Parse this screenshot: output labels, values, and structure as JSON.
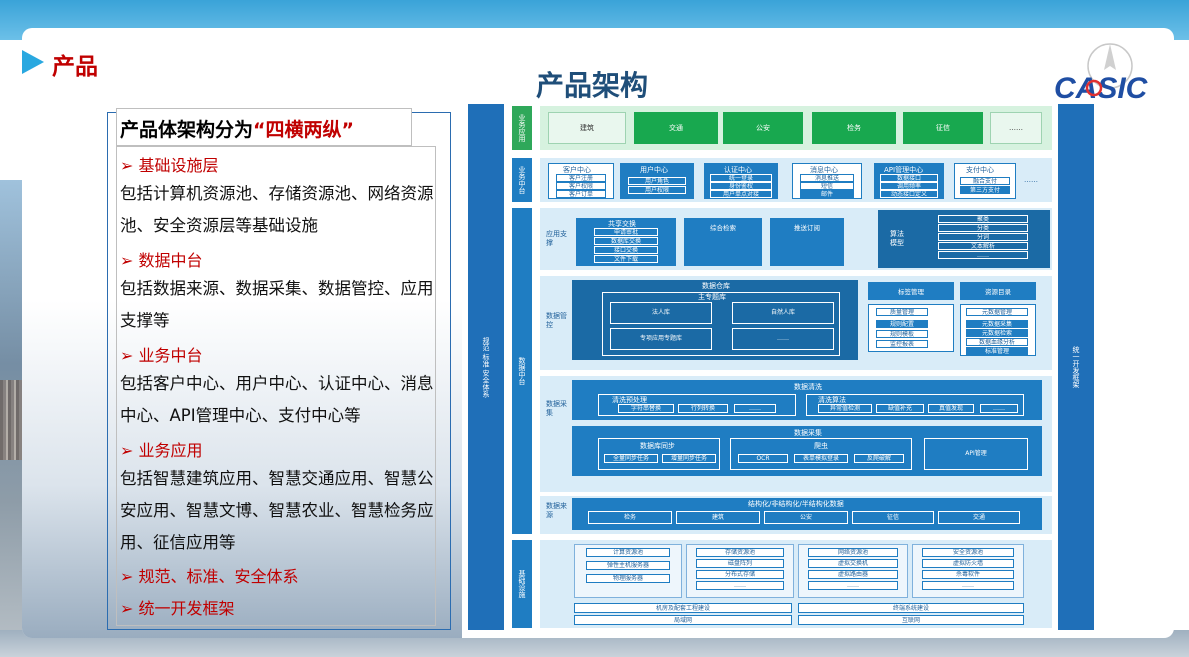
{
  "section_title": "产品",
  "main_title": "产品架构",
  "logo_text": "CASIC",
  "left": {
    "headline_prefix": "产品体架构分为",
    "headline_quote": "“四横两纵”",
    "items": [
      {
        "title": "➢ 基础设施层",
        "desc": "包括计算机资源池、存储资源池、网络资源池、安全资源层等基础设施"
      },
      {
        "title": "➢ 数据中台",
        "desc": "包括数据来源、数据采集、数据管控、应用支撑等"
      },
      {
        "title": "➢ 业务中台",
        "desc": "包括客户中心、用户中心、认证中心、消息中心、API管理中心、支付中心等"
      },
      {
        "title": "➢ 业务应用",
        "desc": "包括智慧建筑应用、智慧交通应用、智慧公安应用、智慧文博、智慧农业、智慧检务应用、征信应用等"
      },
      {
        "title": "➢ 规范、标准、安全体系",
        "desc": ""
      },
      {
        "title": "➢ 统一开发框架",
        "desc": ""
      }
    ]
  },
  "diagram": {
    "left_bar": "规范 标准 安全体系",
    "right_bar": "统一开发框架",
    "biz_app": {
      "tag": "业务应用",
      "items": [
        "建筑",
        "交通",
        "公安",
        "检务",
        "征信",
        "……"
      ]
    },
    "biz_mid": {
      "tag": "业务中台",
      "centers": [
        {
          "title": "客户中心",
          "subs": [
            "客户注册",
            "客户权限",
            "客户订单"
          ]
        },
        {
          "title": "用户中心",
          "subs": [
            "用户角色",
            "用户权限"
          ]
        },
        {
          "title": "认证中心",
          "subs": [
            "统一登录",
            "身份鉴权",
            "用户单点对接"
          ]
        },
        {
          "title": "消息中心",
          "subs": [
            "消息推送",
            "短信",
            "邮件"
          ]
        },
        {
          "title": "API管理中心",
          "subs": [
            "数据接口",
            "调用频率",
            "动态接口定义"
          ]
        },
        {
          "title": "支付中心",
          "subs": [
            "融合支付",
            "第三方支付"
          ]
        }
      ],
      "more": "……"
    },
    "data_mid_tag": "数据中台",
    "app_support": {
      "tag": "应用支撑",
      "share_title": "共享交换",
      "share_items": [
        "申请审批",
        "数据库交换",
        "接口交换",
        "文件下载"
      ],
      "search": "综合检索",
      "push": "推送订阅",
      "algo_tag": "算法模型",
      "algo_items": [
        "聚类",
        "分类",
        "分词",
        "文本解析",
        "……"
      ]
    },
    "data_govern": {
      "tag": "数据管控",
      "warehouse": "数据仓库",
      "theme": "主专题库",
      "corp": "法人库",
      "nature": "自然人库",
      "special": "专项应用专题库",
      "more": "……",
      "label_mgmt": "标签管理",
      "label_items": [
        "质量管理",
        "规则配置",
        "规则模板",
        "监控报表"
      ],
      "res_catalog": "资源目录",
      "res_items": [
        "元数据管理",
        "元数据采集",
        "元数据检索",
        "数据血缘分析",
        "标准管理"
      ]
    },
    "data_collect": {
      "tag": "数据采集",
      "clean": "数据清洗",
      "pre": "清洗预处理",
      "pre_items": [
        "字符串替换",
        "行列转换",
        "……"
      ],
      "algo": "清洗算法",
      "algo_items": [
        "异常值检测",
        "缺值补充",
        "真值发现",
        "……"
      ],
      "gather": "数据采集",
      "sync": "数据库同步",
      "sync_items": [
        "全量同步任务",
        "增量同步任务"
      ],
      "crawler": "爬虫",
      "crawler_items": [
        "OCR",
        "表单模拟登录",
        "反爬破解"
      ],
      "api": "API管理"
    },
    "data_source": {
      "tag": "数据来源",
      "title": "结构化/非结构化/半结构化数据",
      "items": [
        "检务",
        "建筑",
        "公安",
        "征信",
        "交通"
      ]
    },
    "infra": {
      "tag": "基础设施",
      "pools": [
        {
          "title": "计算资源池",
          "items": [
            "弹性主机服务器",
            "物理服务器"
          ]
        },
        {
          "title": "存储资源池",
          "items": [
            "磁盘阵列",
            "分布式存储",
            "……"
          ]
        },
        {
          "title": "网络资源池",
          "items": [
            "虚拟交换机",
            "虚拟路由器",
            "……"
          ]
        },
        {
          "title": "安全资源池",
          "items": [
            "虚拟防火墙",
            "杀毒软件",
            "……"
          ]
        }
      ],
      "room": "机房及配套工程建设",
      "terminal": "终端系统建设",
      "lan": "局域网",
      "internet": "互联网"
    }
  }
}
